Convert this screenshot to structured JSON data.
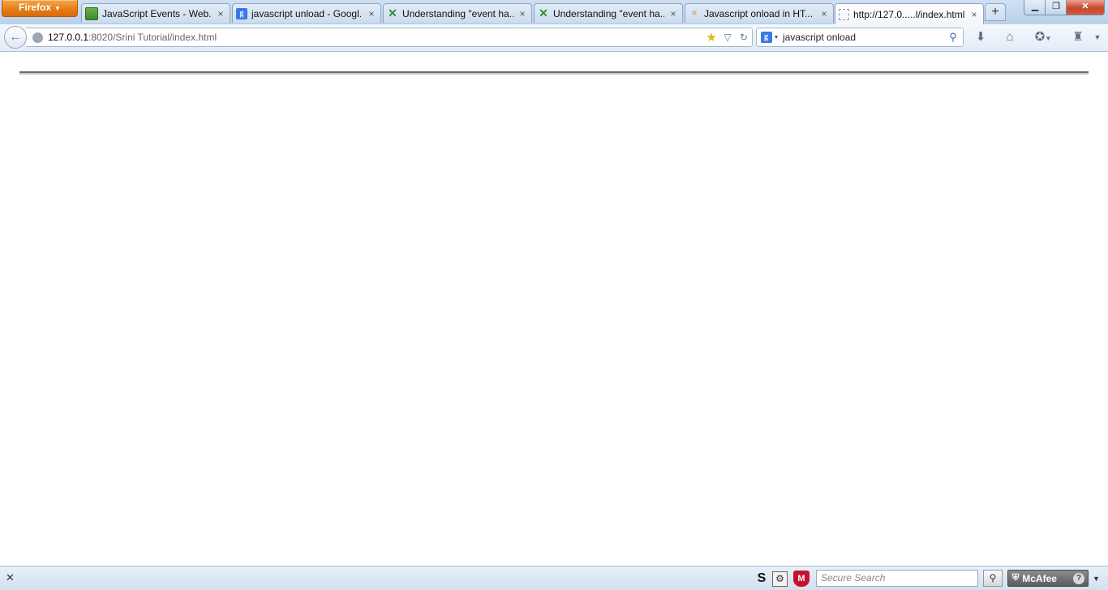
{
  "browser": {
    "menu_label": "Firefox",
    "tabs": [
      {
        "title": "JavaScript Events - Web...",
        "icon": "calendar-icon",
        "active": false
      },
      {
        "title": "javascript unload - Googl...",
        "icon": "google-icon",
        "active": false
      },
      {
        "title": "Understanding \"event ha...",
        "icon": "x-logo-icon",
        "active": false
      },
      {
        "title": "Understanding \"event ha...",
        "icon": "x-logo-icon",
        "active": false
      },
      {
        "title": "Javascript onload in HT...",
        "icon": "stackoverflow-icon",
        "active": false
      },
      {
        "title": "http://127.0.....l/index.html",
        "icon": "blank-page-icon",
        "active": true
      }
    ],
    "close_glyph": "×",
    "newtab_glyph": "+"
  },
  "navbar": {
    "url_host": "127.0.0.1",
    "url_rest": ":8020/Srini Tutorial/index.html",
    "search_engine": "Google",
    "search_value": "javascript onload"
  },
  "addon_bar": {
    "secure_search_placeholder": "Secure Search",
    "mcafee_label": "McAfee",
    "s_label": "S"
  },
  "colors": {
    "firefox_orange": "#e47a14",
    "chrome_blue": "#cfe0f3",
    "mcafee_red": "#c8102e",
    "hr_line": "#6d6d6d"
  }
}
